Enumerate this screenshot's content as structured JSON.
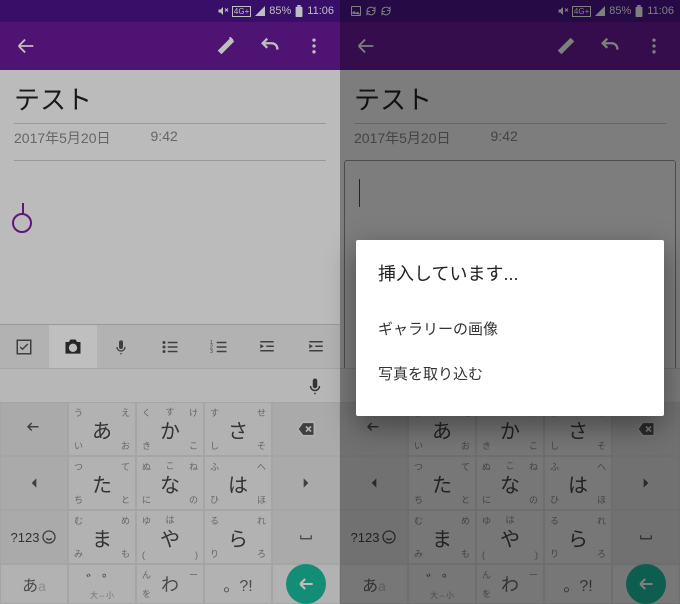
{
  "status": {
    "battery": "85%",
    "time": "11:06",
    "net": "4G+"
  },
  "note": {
    "title": "テスト",
    "date": "2017年5月20日",
    "time": "9:42"
  },
  "bottombar": {
    "lang": "あ",
    "langsub": "大⇔小",
    "sym1": "゛゜",
    "sym2": "。?!"
  },
  "kbd_alt": "?123",
  "keys": {
    "r1": [
      {
        "m": "あ",
        "tl": "う",
        "tr": "え",
        "bl": "い",
        "br": "お"
      },
      {
        "m": "か",
        "tl": "く",
        "tr": "け",
        "bl": "き",
        "br": "こ",
        "top": "す"
      },
      {
        "m": "さ",
        "tl": "す",
        "tr": "せ",
        "bl": "し",
        "br": "そ"
      }
    ],
    "r2": [
      {
        "m": "た",
        "tl": "つ",
        "tr": "て",
        "bl": "ち",
        "br": "と"
      },
      {
        "m": "な",
        "tl": "ぬ",
        "tr": "ね",
        "bl": "に",
        "br": "の",
        "top": "こ"
      },
      {
        "m": "は",
        "tl": "ふ",
        "tr": "へ",
        "bl": "ひ",
        "br": "ほ"
      }
    ],
    "r3": [
      {
        "m": "ま",
        "tl": "む",
        "tr": "め",
        "bl": "み",
        "br": "も"
      },
      {
        "m": "や",
        "tl": "ゆ",
        "tr": "",
        "bl": "(",
        "br": ")",
        "top": "は"
      },
      {
        "m": "ら",
        "tl": "る",
        "tr": "れ",
        "bl": "り",
        "br": "ろ"
      }
    ],
    "r4": {
      "m": "わ",
      "tl": "ん",
      "tr": "ー",
      "bl": "を",
      "br": ""
    }
  },
  "dialog": {
    "title": "挿入しています...",
    "opt1": "ギャラリーの画像",
    "opt2": "写真を取り込む"
  }
}
